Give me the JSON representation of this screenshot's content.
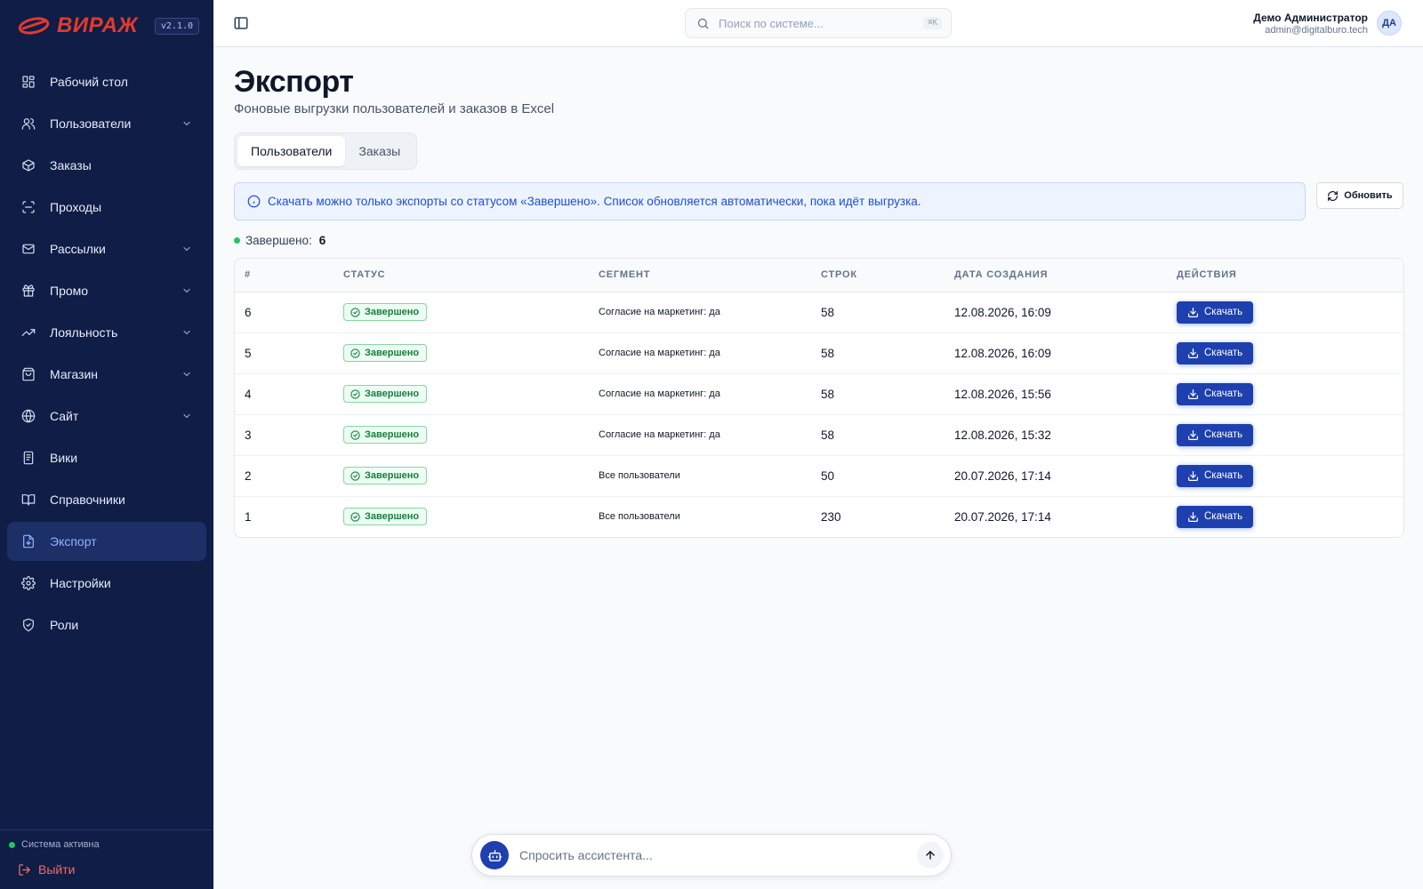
{
  "brand": {
    "name": "ВИРАЖ",
    "version": "v2.1.0",
    "logo_color": "#e33a2c"
  },
  "sidebar": {
    "items": [
      {
        "label": "Рабочий стол",
        "icon": "dashboard-icon"
      },
      {
        "label": "Пользователи",
        "icon": "users-icon",
        "expandable": true
      },
      {
        "label": "Заказы",
        "icon": "package-icon"
      },
      {
        "label": "Проходы",
        "icon": "scan-icon"
      },
      {
        "label": "Рассылки",
        "icon": "mail-icon",
        "expandable": true
      },
      {
        "label": "Промо",
        "icon": "gift-icon",
        "expandable": true
      },
      {
        "label": "Лояльность",
        "icon": "trending-up-icon",
        "expandable": true
      },
      {
        "label": "Магазин",
        "icon": "shopping-bag-icon",
        "expandable": true
      },
      {
        "label": "Сайт",
        "icon": "globe-icon",
        "expandable": true
      },
      {
        "label": "Вики",
        "icon": "notebook-icon"
      },
      {
        "label": "Справочники",
        "icon": "book-open-icon"
      },
      {
        "label": "Экспорт",
        "icon": "file-download-icon",
        "active": true
      },
      {
        "label": "Настройки",
        "icon": "gear-icon"
      },
      {
        "label": "Роли",
        "icon": "shield-icon"
      }
    ],
    "system_status": "Система активна",
    "logout_label": "Выйти"
  },
  "topbar": {
    "search_placeholder": "Поиск по системе...",
    "search_shortcut": "⌘K",
    "user_name": "Демо Администратор",
    "user_email": "admin@digitalburo.tech",
    "avatar_initials": "ДА"
  },
  "page": {
    "title": "Экспорт",
    "subtitle": "Фоновые выгрузки пользователей и заказов в Excel",
    "tabs": [
      {
        "label": "Пользователи",
        "active": true
      },
      {
        "label": "Заказы",
        "active": false
      }
    ],
    "info_text": "Скачать можно только экспорты со статусом «Завершено». Список обновляется автоматически, пока идёт выгрузка.",
    "refresh_label": "Обновить",
    "count_label": "Завершено:",
    "count_value": "6"
  },
  "table": {
    "columns": [
      "#",
      "СТАТУС",
      "СЕГМЕНТ",
      "СТРОК",
      "ДАТА СОЗДАНИЯ",
      "ДЕЙСТВИЯ"
    ],
    "rows": [
      {
        "id": "6",
        "status": "Завершено",
        "segment": "Согласие на маркетинг: да",
        "rows": "58",
        "created": "12.08.2026, 16:09",
        "action": "Скачать"
      },
      {
        "id": "5",
        "status": "Завершено",
        "segment": "Согласие на маркетинг: да",
        "rows": "58",
        "created": "12.08.2026, 16:09",
        "action": "Скачать"
      },
      {
        "id": "4",
        "status": "Завершено",
        "segment": "Согласие на маркетинг: да",
        "rows": "58",
        "created": "12.08.2026, 15:56",
        "action": "Скачать"
      },
      {
        "id": "3",
        "status": "Завершено",
        "segment": "Согласие на маркетинг: да",
        "rows": "58",
        "created": "12.08.2026, 15:32",
        "action": "Скачать"
      },
      {
        "id": "2",
        "status": "Завершено",
        "segment": "Все пользователи",
        "rows": "50",
        "created": "20.07.2026, 17:14",
        "action": "Скачать"
      },
      {
        "id": "1",
        "status": "Завершено",
        "segment": "Все пользователи",
        "rows": "230",
        "created": "20.07.2026, 17:14",
        "action": "Скачать"
      }
    ]
  },
  "assistant": {
    "placeholder": "Спросить ассистента..."
  },
  "colors": {
    "sidebar_bg": "#0f1d47",
    "accent": "#1e40af",
    "success": "#15803d",
    "info": "#1d4ed8"
  }
}
